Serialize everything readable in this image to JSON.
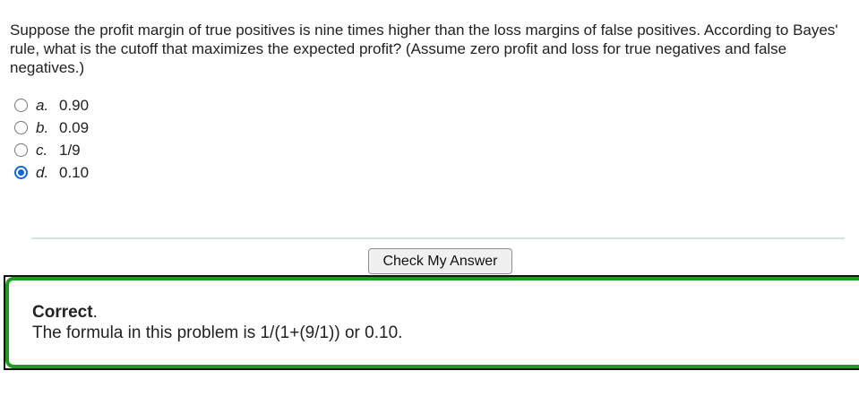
{
  "question": {
    "text": "Suppose the profit margin of true positives is nine times higher than the loss margins of false positives. According to Bayes' rule, what is the cutoff that maximizes the expected profit? (Assume zero profit and loss for true negatives and false negatives.)"
  },
  "options": [
    {
      "letter": "a.",
      "value": "0.90",
      "selected": false
    },
    {
      "letter": "b.",
      "value": "0.09",
      "selected": false
    },
    {
      "letter": "c.",
      "value": "1/9",
      "selected": false
    },
    {
      "letter": "d.",
      "value": "0.10",
      "selected": true
    }
  ],
  "check_button": {
    "label": "Check My Answer"
  },
  "feedback": {
    "status_word": "Correct",
    "status_punct": ".",
    "explanation": "The formula in this problem is 1/(1+(9/1)) or 0.10."
  },
  "colors": {
    "accent": "#0f6ad8",
    "correct_border": "#1e9a1e"
  }
}
